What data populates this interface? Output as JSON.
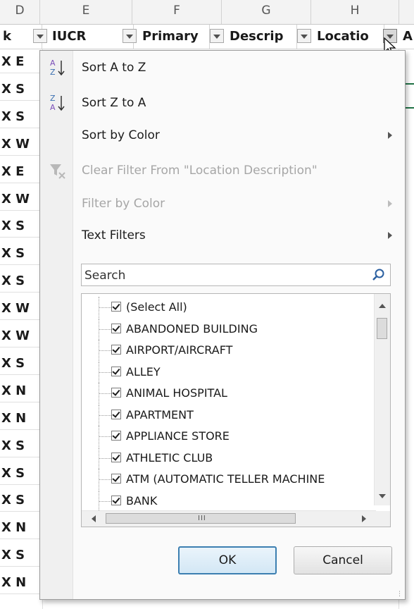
{
  "sheet": {
    "column_letters": [
      {
        "letter": "D"
      },
      {
        "letter": "E"
      },
      {
        "letter": "F"
      },
      {
        "letter": "G"
      },
      {
        "letter": "H"
      }
    ],
    "header_cells": [
      {
        "text": "k"
      },
      {
        "text": "IUCR"
      },
      {
        "text": "Primary"
      },
      {
        "text": "Descrip"
      },
      {
        "text": "Locatio"
      },
      {
        "text": "A"
      }
    ],
    "rows": [
      "X E",
      "X S",
      "X S",
      "X W",
      "X E",
      "X W",
      "X S",
      "X S",
      "X S",
      "X W",
      "X W",
      "X S",
      "X N",
      "X N",
      "X S",
      "X S",
      "X S",
      "X N",
      "X S",
      "X N"
    ]
  },
  "menu": {
    "sort_az": "Sort A to Z",
    "sort_za": "Sort Z to A",
    "sort_by_color": "Sort by Color",
    "clear_filter": "Clear Filter From \"Location Description\"",
    "filter_by_color": "Filter by Color",
    "text_filters": "Text Filters"
  },
  "search": {
    "placeholder": "Search"
  },
  "filter_list": [
    {
      "label": "(Select All)",
      "checked": true
    },
    {
      "label": "ABANDONED BUILDING",
      "checked": true
    },
    {
      "label": "AIRPORT/AIRCRAFT",
      "checked": true
    },
    {
      "label": "ALLEY",
      "checked": true
    },
    {
      "label": "ANIMAL HOSPITAL",
      "checked": true
    },
    {
      "label": "APARTMENT",
      "checked": true
    },
    {
      "label": "APPLIANCE STORE",
      "checked": true
    },
    {
      "label": "ATHLETIC CLUB",
      "checked": true
    },
    {
      "label": "ATM (AUTOMATIC TELLER MACHINE",
      "checked": true
    },
    {
      "label": "BANK",
      "checked": true
    }
  ],
  "hscroll_grip": "III",
  "buttons": {
    "ok": "OK",
    "cancel": "Cancel"
  },
  "colors": {
    "accent": "#3c7fb1",
    "selection_border": "#217346"
  }
}
